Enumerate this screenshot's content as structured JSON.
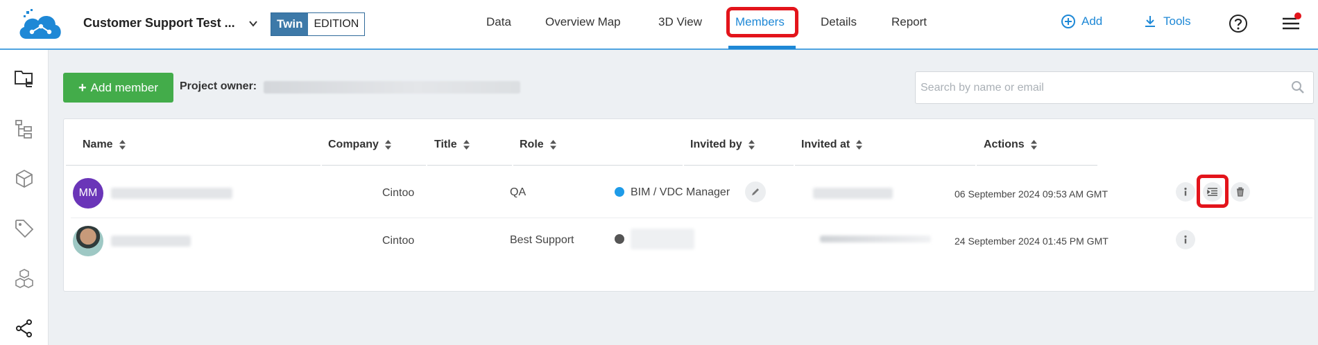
{
  "header": {
    "project_name": "Customer Support Test ...",
    "edition_badge": "Twin",
    "edition_label": "EDITION",
    "nav": [
      "Data",
      "Overview Map",
      "3D View",
      "Members",
      "Details",
      "Report"
    ],
    "active_nav": "Members",
    "add_label": "Add",
    "tools_label": "Tools",
    "accent_color": "#1e88d6",
    "notification_color": "#e3141b"
  },
  "sidebar": {
    "icons": [
      "folder-tree-icon",
      "hierarchy-icon",
      "cube-icon",
      "tag-icon",
      "cubes-icon",
      "share-icon"
    ]
  },
  "toolbar": {
    "add_member_label": "Add member",
    "add_member_color": "#43ac4a",
    "owner_label": "Project owner:"
  },
  "search": {
    "placeholder": "Search by name or email",
    "value": ""
  },
  "table": {
    "columns": [
      "Name",
      "Company",
      "Title",
      "Role",
      "Invited by",
      "Invited at",
      "Actions"
    ],
    "rows": [
      {
        "avatar_initials": "MM",
        "company": "Cintoo",
        "title": "QA",
        "role": "BIM / VDC Manager",
        "role_dot_color": "#1e9be8",
        "invited_at": "06 September 2024 09:53 AM GMT",
        "actions": [
          "info-icon",
          "list-icon",
          "trash-icon"
        ]
      },
      {
        "avatar_initials": "",
        "company": "Cintoo",
        "title": "Best Support",
        "role": "",
        "role_dot_color": "#555555",
        "invited_at": "24 September 2024 01:45 PM GMT",
        "actions": [
          "info-icon"
        ]
      }
    ]
  }
}
